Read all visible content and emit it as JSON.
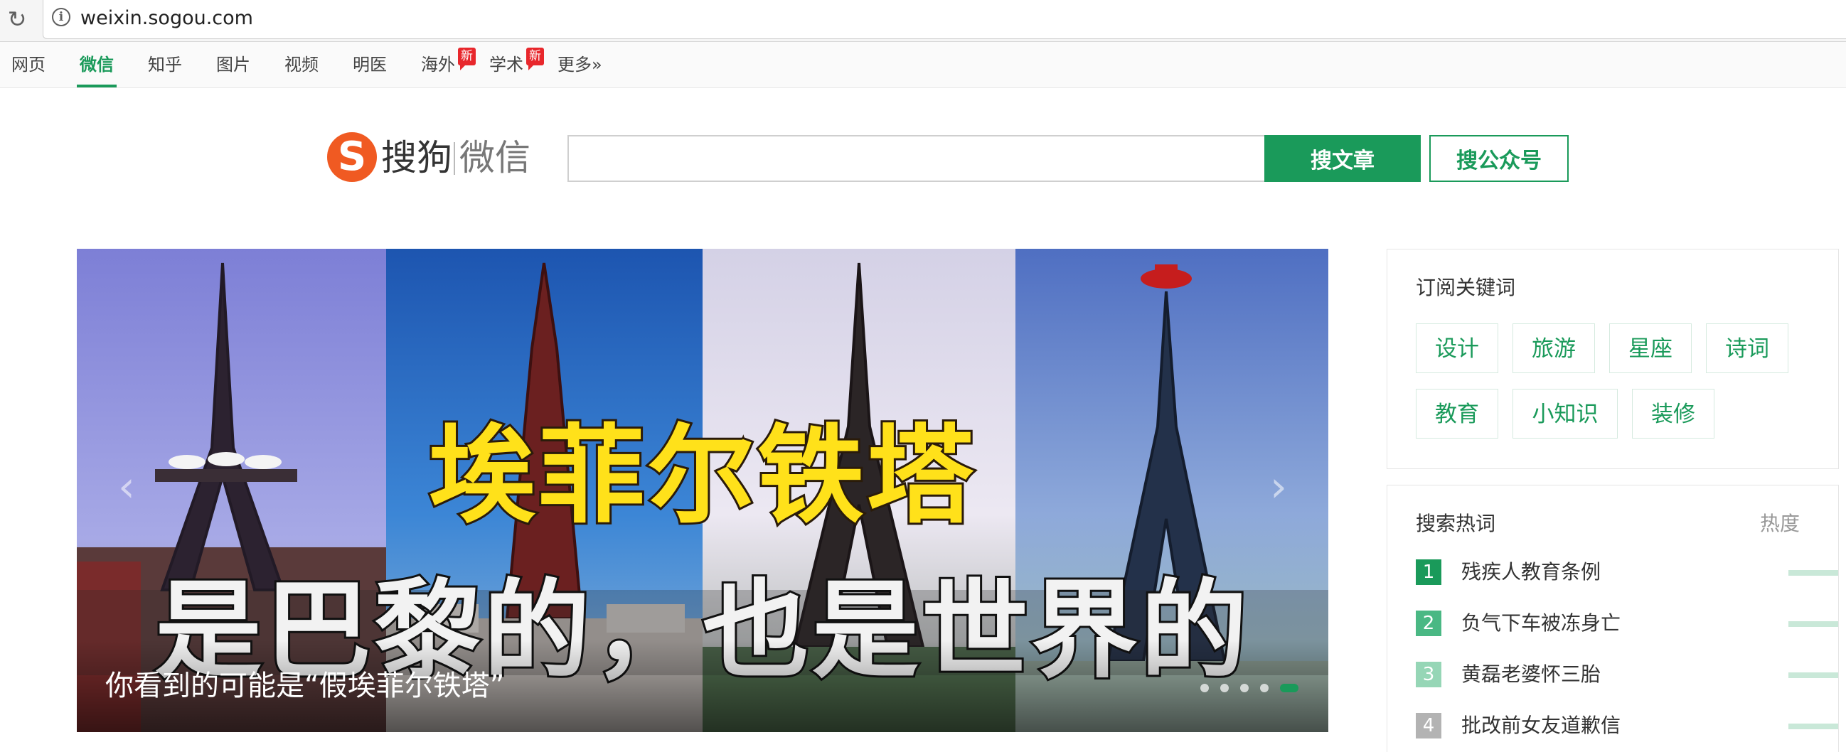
{
  "browser": {
    "url": "weixin.sogou.com"
  },
  "nav": {
    "items": [
      {
        "label": "网页",
        "active": false
      },
      {
        "label": "微信",
        "active": true
      },
      {
        "label": "知乎",
        "active": false
      },
      {
        "label": "图片",
        "active": false
      },
      {
        "label": "视频",
        "active": false
      },
      {
        "label": "明医",
        "active": false
      },
      {
        "label": "海外",
        "active": false,
        "badge": "新"
      },
      {
        "label": "学术",
        "active": false,
        "badge": "新"
      },
      {
        "label": "更多»",
        "active": false
      }
    ]
  },
  "header": {
    "logo_mark": "S",
    "logo_brand": "搜狗",
    "logo_product": "微信",
    "search_value": "",
    "btn_article": "搜文章",
    "btn_account": "搜公众号"
  },
  "banner": {
    "headline1": "埃菲尔铁塔",
    "headline2": "是巴黎的，也是世界的",
    "caption": "你看到的可能是“假埃菲尔铁塔”",
    "slide_count": 5,
    "active_slide": 5
  },
  "subscribe": {
    "title": "订阅关键词",
    "keywords": [
      "设计",
      "旅游",
      "星座",
      "诗词",
      "教育",
      "小知识",
      "装修"
    ]
  },
  "hot": {
    "title": "搜索热词",
    "heat_label": "热度",
    "items": [
      {
        "rank": "1",
        "text": "残疾人教育条例",
        "color": "#1a9a5a"
      },
      {
        "rank": "2",
        "text": "负气下车被冻身亡",
        "color": "#4ab884"
      },
      {
        "rank": "3",
        "text": "黄磊老婆怀三胎",
        "color": "#96d6b6"
      },
      {
        "rank": "4",
        "text": "批改前女友道歉信",
        "color": "#b3b3b3"
      }
    ]
  },
  "colors": {
    "brand_green": "#1a9a5a",
    "logo_orange": "#f05a22",
    "badge_red": "#e8272c"
  }
}
